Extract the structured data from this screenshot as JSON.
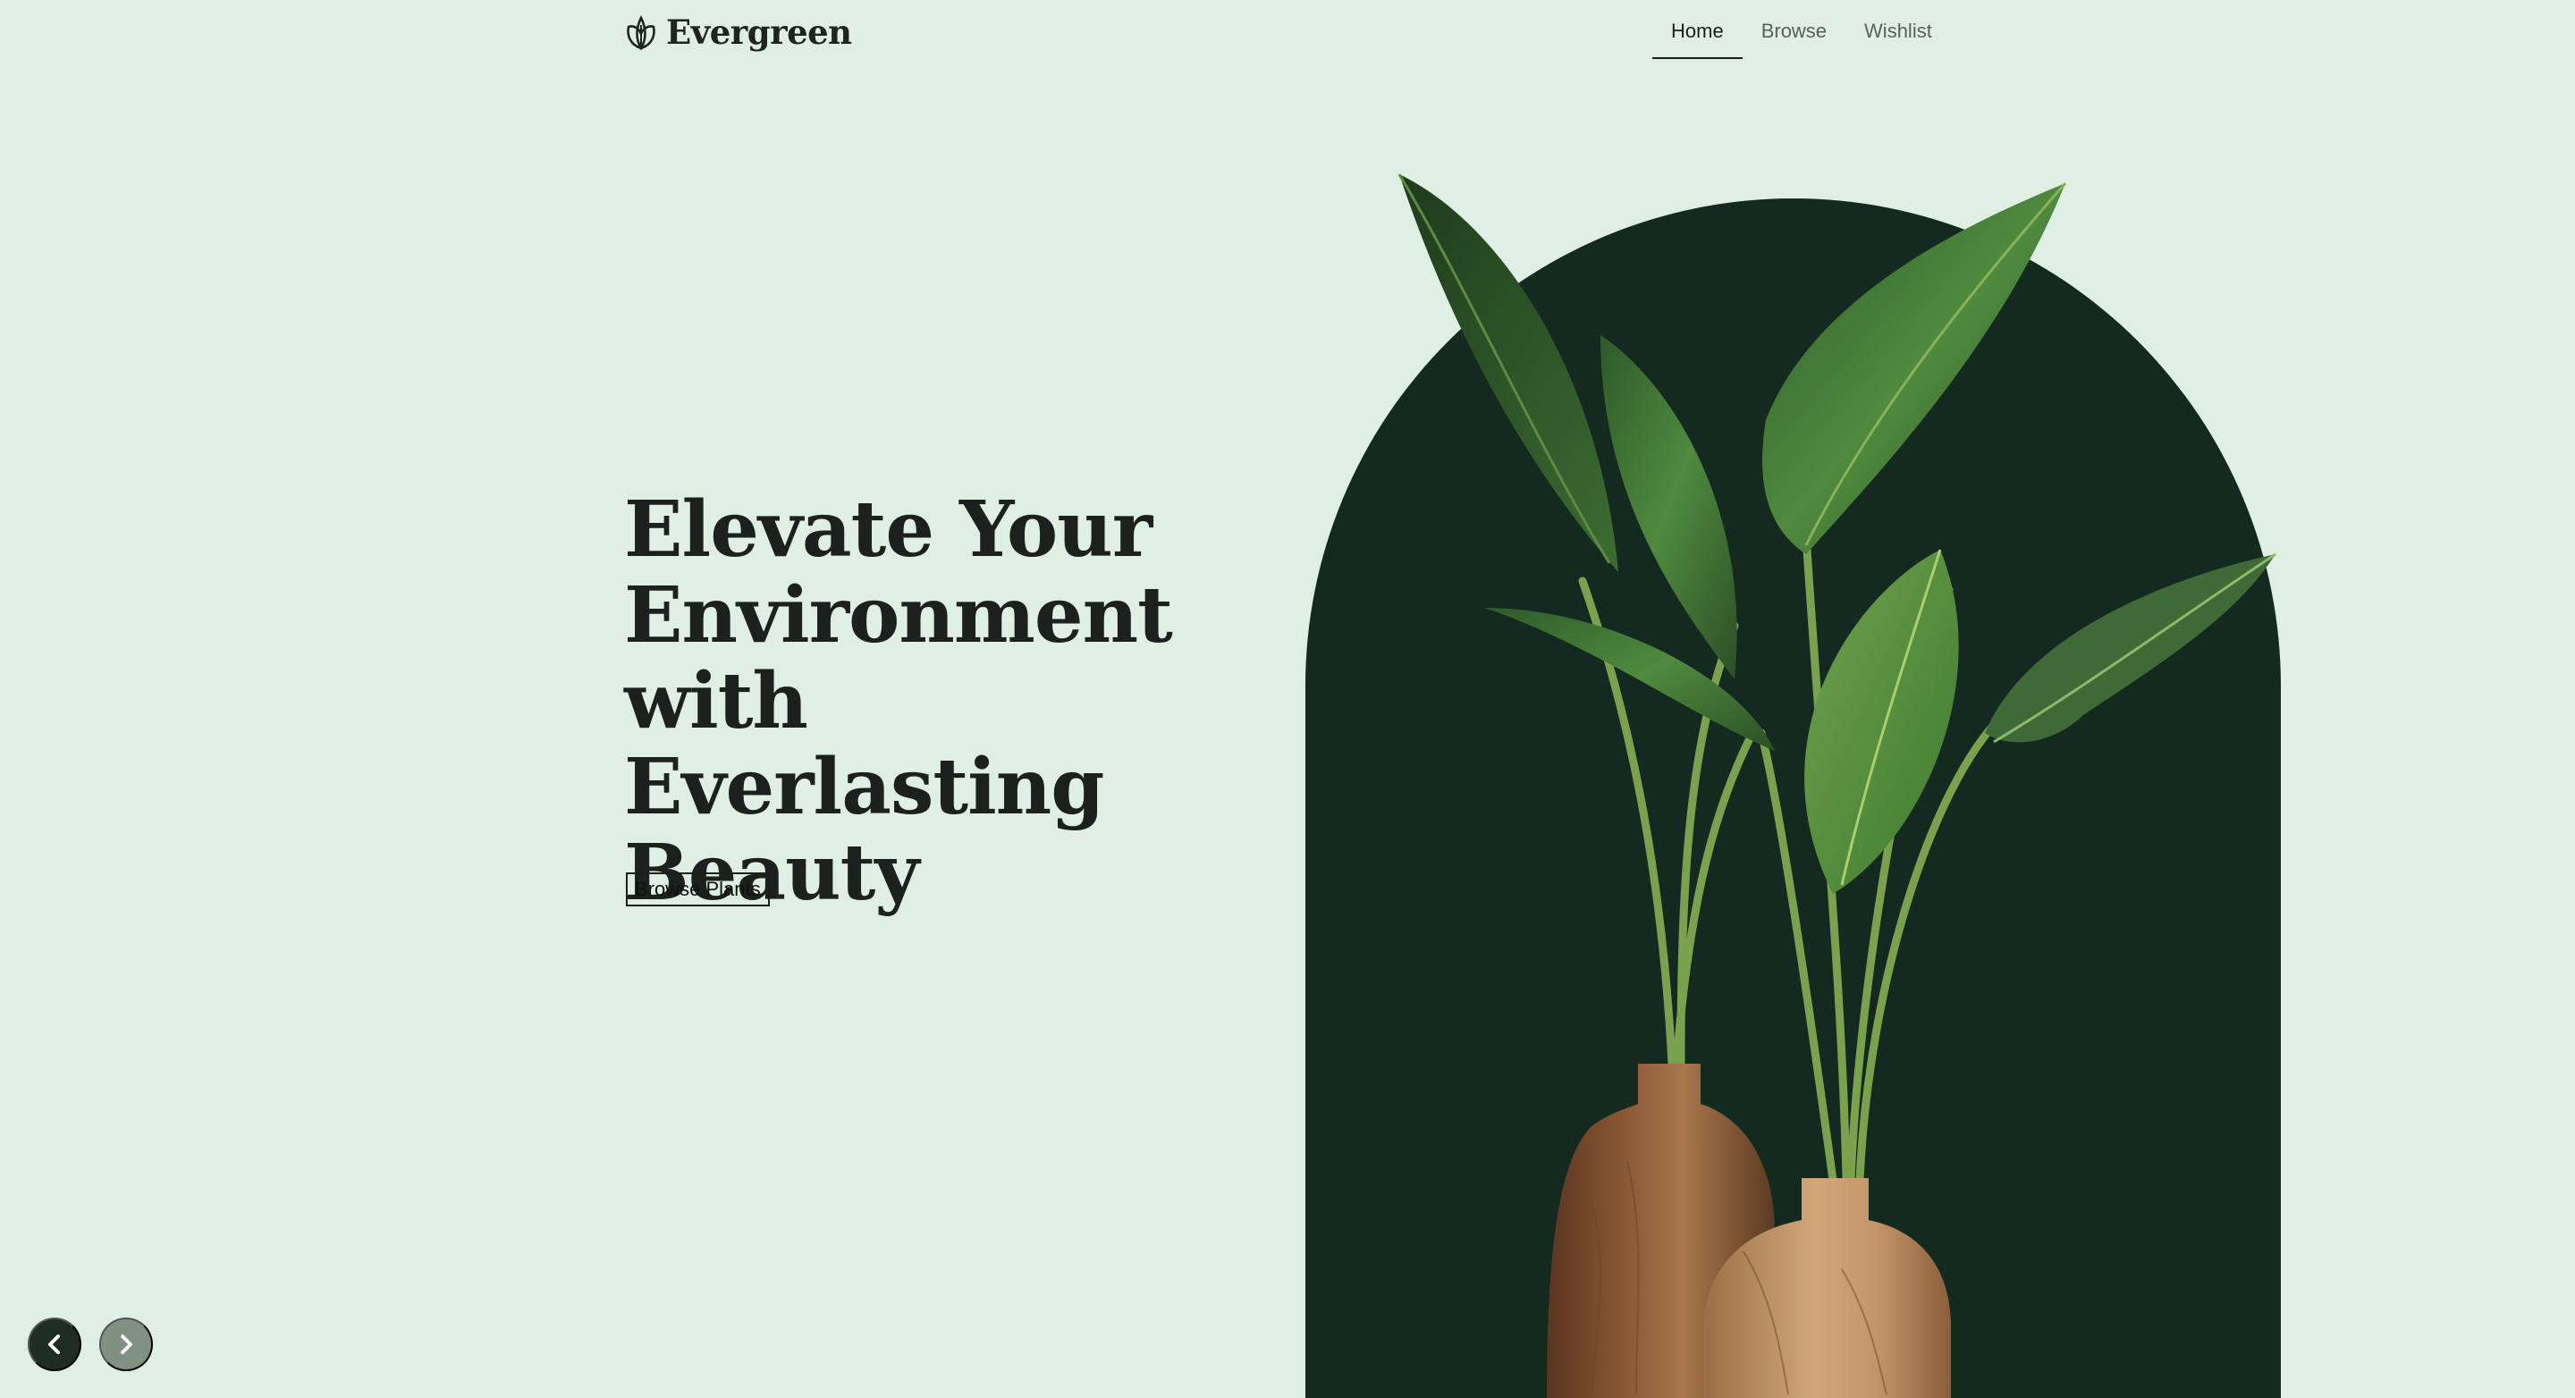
{
  "brand": {
    "name": "Evergreen",
    "logo_icon": "leaf-icon"
  },
  "nav": {
    "items": [
      {
        "label": "Home",
        "active": true
      },
      {
        "label": "Browse",
        "active": false
      },
      {
        "label": "Wishlist",
        "active": false
      }
    ]
  },
  "hero": {
    "title_lines": [
      "Elevate Your",
      "Environment",
      "with Everlasting",
      "Beauty"
    ],
    "cta_label": "Browse Plants",
    "image": "potted-plant-in-wooden-vases"
  },
  "carousel": {
    "prev_icon": "chevron-left-icon",
    "next_icon": "chevron-right-icon"
  },
  "colors": {
    "background": "#e0efe4",
    "arch": "#142a20",
    "text": "#1a1f1c",
    "prev_button": "#1e2e25",
    "next_button": "#7f9183"
  }
}
